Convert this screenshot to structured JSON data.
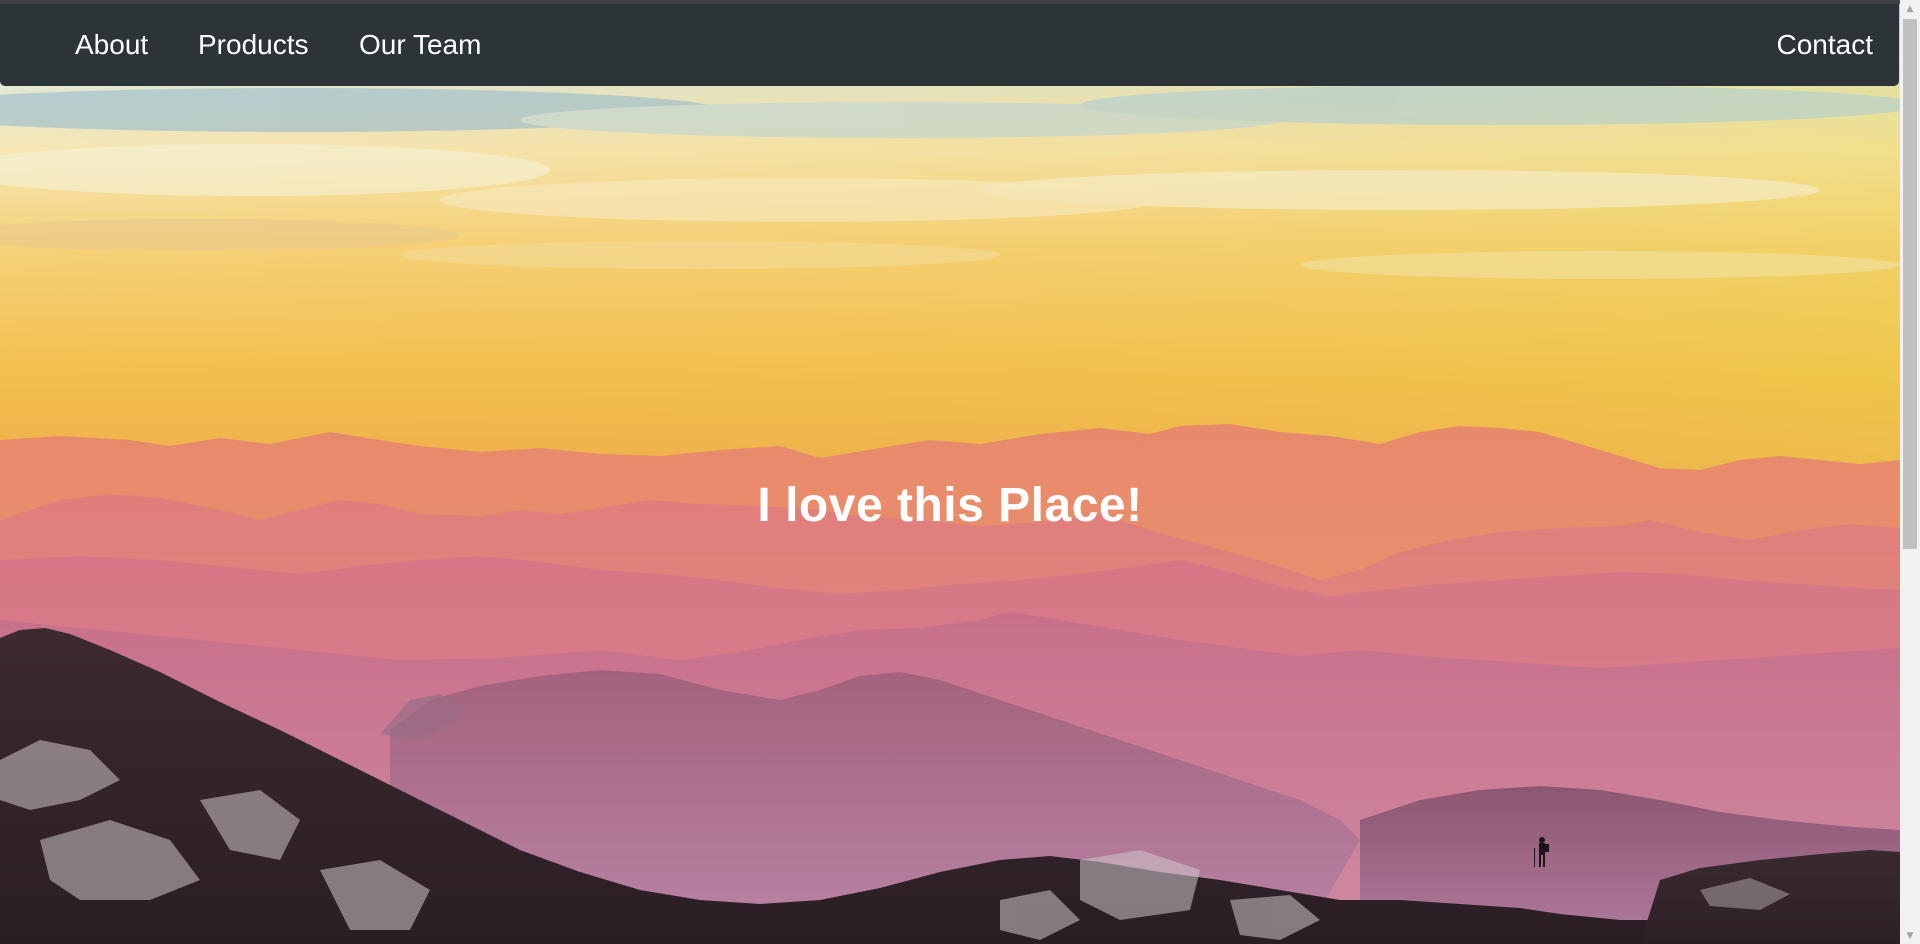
{
  "nav": {
    "links": [
      {
        "label": "About"
      },
      {
        "label": "Products"
      },
      {
        "label": "Our Team"
      }
    ],
    "contact_label": "Contact"
  },
  "hero": {
    "headline": "I love this Place!"
  },
  "colors": {
    "navbar_bg": "#2c3438",
    "nav_text": "#ffffff",
    "headline_text": "#ffffff"
  },
  "scrollbar": {
    "up_icon": "scroll-up-arrow-icon",
    "down_icon": "scroll-down-arrow-icon"
  }
}
